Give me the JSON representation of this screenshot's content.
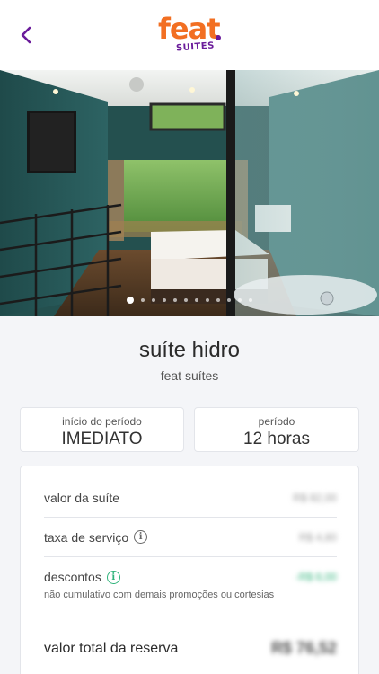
{
  "header": {
    "back_icon": "chevron-left-icon",
    "logo_text": "feat",
    "logo_subtext": "SUITES",
    "brand_orange": "#f26f22",
    "brand_purple": "#6a1b9a"
  },
  "gallery": {
    "image": "hotel suite with bed, glass partition and window to trees",
    "slides_total": 12,
    "active_slide": 1
  },
  "suite": {
    "name": "suíte hidro",
    "hotel": "feat suítes"
  },
  "period": {
    "start_label": "início do período",
    "start_value": "IMEDIATO",
    "length_label": "período",
    "length_value": "12 horas"
  },
  "pricing": {
    "suite_label": "valor da suíte",
    "suite_value": "R$ 82,00",
    "service_label": "taxa de serviço",
    "service_value": "R$ 4,80",
    "discount_label": "descontos",
    "discount_value": "-R$ 6,00",
    "discount_note": "não cumulativo com demais promoções ou cortesias",
    "total_label": "valor total da reserva",
    "total_value": "R$ 76,52",
    "accent_green": "#2eb37a"
  }
}
